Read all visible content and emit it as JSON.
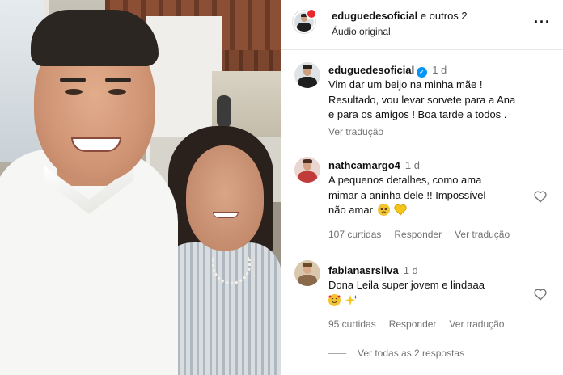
{
  "photo": {
    "icon": "selfie-photo"
  },
  "header": {
    "username": "eduguedesoficial",
    "others": "e outros 2",
    "audio": "Áudio original",
    "more_icon": "more-horizontal-icon"
  },
  "comments": [
    {
      "username": "eduguedesoficial",
      "verified": true,
      "ago": "1 d",
      "lines": [
        "Vim dar um beijo na minha mãe !",
        "Resultado, vou levar sorvete para a Ana",
        "e para os amigos ! Boa tarde a todos ."
      ],
      "translate": "Ver tradução"
    },
    {
      "username": "nathcamargo4",
      "ago": "1 d",
      "lines": [
        "A pequenos detalhes, como ama",
        "mimar a aninha dele !! Impossível",
        "não amar"
      ],
      "emojis": [
        "pleading-face",
        "yellow-heart"
      ],
      "likes": "107 curtidas",
      "reply": "Responder",
      "translate": "Ver tradução"
    },
    {
      "username": "fabianasrsilva",
      "ago": "1 d",
      "lines": [
        "Dona Leila super jovem e lindaaa"
      ],
      "emojis": [
        "smiling-face-with-hearts",
        "sparkles"
      ],
      "likes": "95 curtidas",
      "reply": "Responder",
      "translate": "Ver tradução"
    }
  ],
  "view_replies": "Ver todas as 2 respostas",
  "colors": {
    "verified": "#0095f6",
    "secondary_text": "#737373",
    "badge": "#e8272e"
  }
}
